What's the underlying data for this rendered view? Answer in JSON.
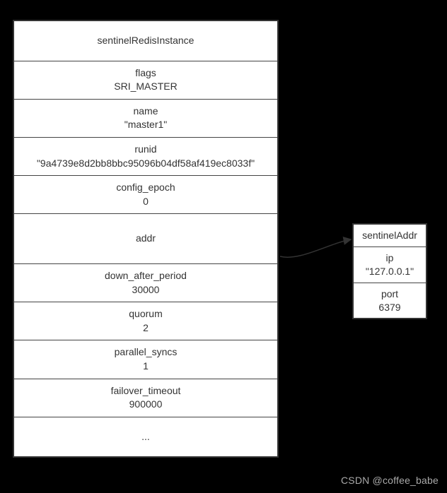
{
  "main": {
    "title": "sentinelRedisInstance",
    "rows": [
      {
        "field": "flags",
        "value": "SRI_MASTER"
      },
      {
        "field": "name",
        "value": "\"master1\""
      },
      {
        "field": "runid",
        "value": "\"9a4739e8d2bb8bbc95096b04df58af419ec8033f\""
      },
      {
        "field": "config_epoch",
        "value": "0"
      },
      {
        "field": "addr",
        "value": ""
      },
      {
        "field": "down_after_period",
        "value": "30000"
      },
      {
        "field": "quorum",
        "value": "2"
      },
      {
        "field": "parallel_syncs",
        "value": "1"
      },
      {
        "field": "failover_timeout",
        "value": "900000"
      },
      {
        "field": "...",
        "value": ""
      }
    ]
  },
  "side": {
    "title": "sentinelAddr",
    "rows": [
      {
        "field": "ip",
        "value": "\"127.0.0.1\""
      },
      {
        "field": "port",
        "value": "6379"
      }
    ]
  },
  "watermark": "CSDN @coffee_babe"
}
